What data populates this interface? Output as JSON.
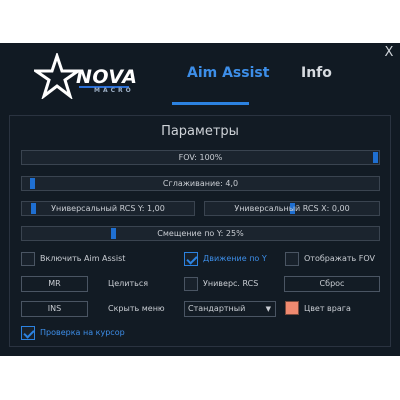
{
  "window": {
    "close_label": "X"
  },
  "logo": {
    "brand": "NOVA",
    "sub": "MACRO"
  },
  "tabs": [
    {
      "label": "Aim Assist",
      "active": true
    },
    {
      "label": "Info",
      "active": false
    }
  ],
  "panel": {
    "title": "Параметры",
    "sliders": {
      "fov": {
        "label": "FOV: 100%",
        "fraction": 1.0
      },
      "smoothing": {
        "label": "Сглаживание: 4,0",
        "fraction": 0.02
      },
      "rcs_y": {
        "label": "Универсальный RCS Y: 1,00",
        "fraction": 0.05
      },
      "rcs_x": {
        "label": "Универсальный RCS X: 0,00",
        "fraction": 0.5
      },
      "offset_y": {
        "label": "Смещение по Y: 25%",
        "fraction": 0.25
      }
    },
    "checkboxes": {
      "enable_aim": {
        "label": "Включить Aim Assist",
        "checked": false
      },
      "move_y": {
        "label": "Движение по Y",
        "checked": true
      },
      "show_fov": {
        "label": "Отображать FOV",
        "checked": false
      },
      "universal_rcs": {
        "label": "Универс. RCS",
        "checked": false
      },
      "cursor_check": {
        "label": "Проверка на курсор",
        "checked": true
      }
    },
    "keybinds": {
      "aim_key": {
        "value": "MR",
        "label": "Целиться"
      },
      "hide_key": {
        "value": "INS",
        "label": "Скрыть меню"
      }
    },
    "buttons": {
      "reset": "Сброс"
    },
    "select": {
      "value": "Стандартный",
      "arrow": "▼"
    },
    "enemy_color": {
      "label": "Цвет врага",
      "color": "#f08a70"
    }
  },
  "colors": {
    "accent": "#2c82e0",
    "background": "#111a23"
  }
}
